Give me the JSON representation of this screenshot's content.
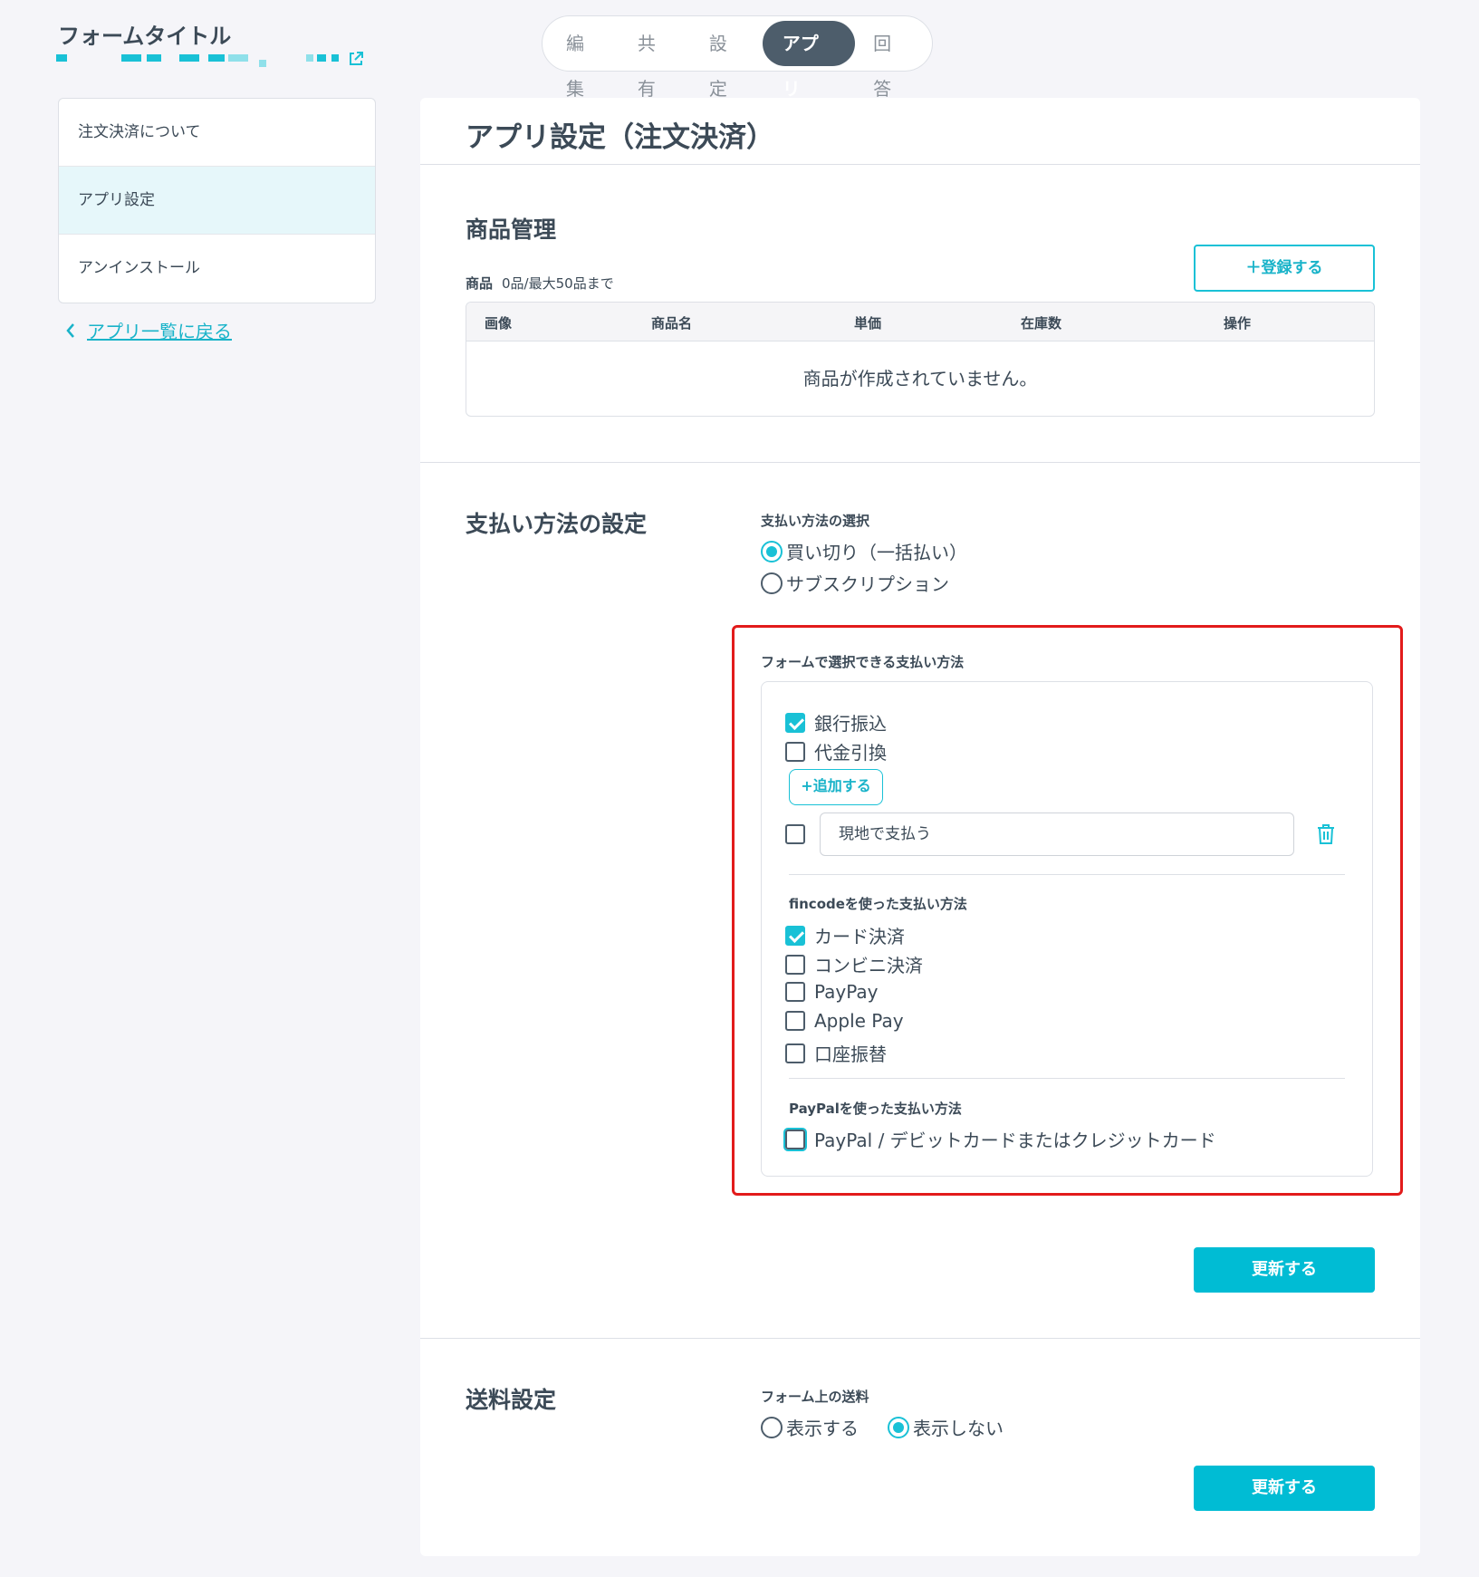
{
  "header": {
    "form_title": "フォームタイトル"
  },
  "tabs": [
    {
      "label": "編集",
      "active": false
    },
    {
      "label": "共有",
      "active": false
    },
    {
      "label": "設定",
      "active": false
    },
    {
      "label": "アプリ",
      "active": true
    },
    {
      "label": "回答",
      "active": false
    }
  ],
  "sidebar": {
    "items": [
      {
        "label": "注文決済について",
        "active": false
      },
      {
        "label": "アプリ設定",
        "active": true
      },
      {
        "label": "アンインストール",
        "active": false
      }
    ],
    "back_link": "アプリ一覧に戻る"
  },
  "main": {
    "title": "アプリ設定（注文決済）",
    "products": {
      "section_title": "商品管理",
      "register_button": "＋登録する",
      "count_label": "商品",
      "count_text": "0品/最大50品まで",
      "columns": [
        "画像",
        "商品名",
        "単価",
        "在庫数",
        "操作"
      ],
      "empty_text": "商品が作成されていません。"
    },
    "payment": {
      "section_title": "支払い方法の設定",
      "type_label": "支払い方法の選択",
      "types": [
        {
          "label": "買い切り（一括払い）",
          "selected": true
        },
        {
          "label": "サブスクリプション",
          "selected": false
        }
      ],
      "methods_label": "フォームで選択できる支払い方法",
      "basic_methods": [
        {
          "label": "銀行振込",
          "checked": true
        },
        {
          "label": "代金引換",
          "checked": false
        }
      ],
      "add_button": "+追加する",
      "custom_method": {
        "value": "現地で支払う",
        "checked": false
      },
      "fincode_label": "fincodeを使った支払い方法",
      "fincode_methods": [
        {
          "label": "カード決済",
          "checked": true
        },
        {
          "label": "コンビニ決済",
          "checked": false
        },
        {
          "label": "PayPay",
          "checked": false
        },
        {
          "label": "Apple Pay",
          "checked": false
        },
        {
          "label": "口座振替",
          "checked": false
        }
      ],
      "paypal_label": "PayPalを使った支払い方法",
      "paypal_methods": [
        {
          "label": "PayPal / デビットカードまたはクレジットカード",
          "checked": false
        }
      ],
      "update_button": "更新する"
    },
    "shipping": {
      "section_title": "送料設定",
      "label": "フォーム上の送料",
      "options": [
        {
          "label": "表示する",
          "selected": false
        },
        {
          "label": "表示しない",
          "selected": true
        }
      ],
      "update_button": "更新する"
    }
  },
  "colors": {
    "accent": "#19c1d6",
    "primary_button": "#00bcd4",
    "highlight": "#e21b1b",
    "active_tab": "#4d5d6b"
  }
}
